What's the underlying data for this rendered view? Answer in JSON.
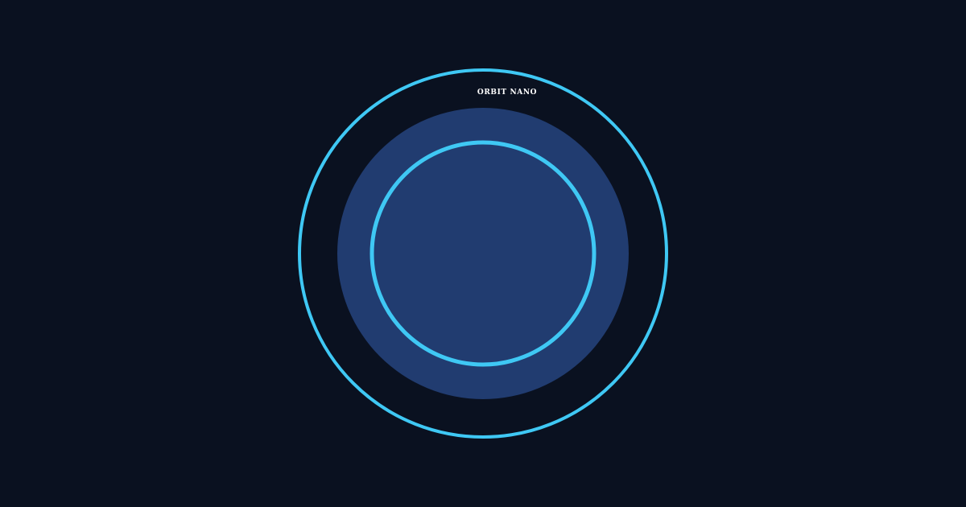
{
  "brand": {
    "name": "ORBIT NANO"
  },
  "colors": {
    "background": "#0a1120",
    "ring": "#3fc8f4",
    "disc": "#213c70",
    "text": "#ffffff"
  },
  "icons": {
    "emblem": "orbit-rings-icon"
  }
}
